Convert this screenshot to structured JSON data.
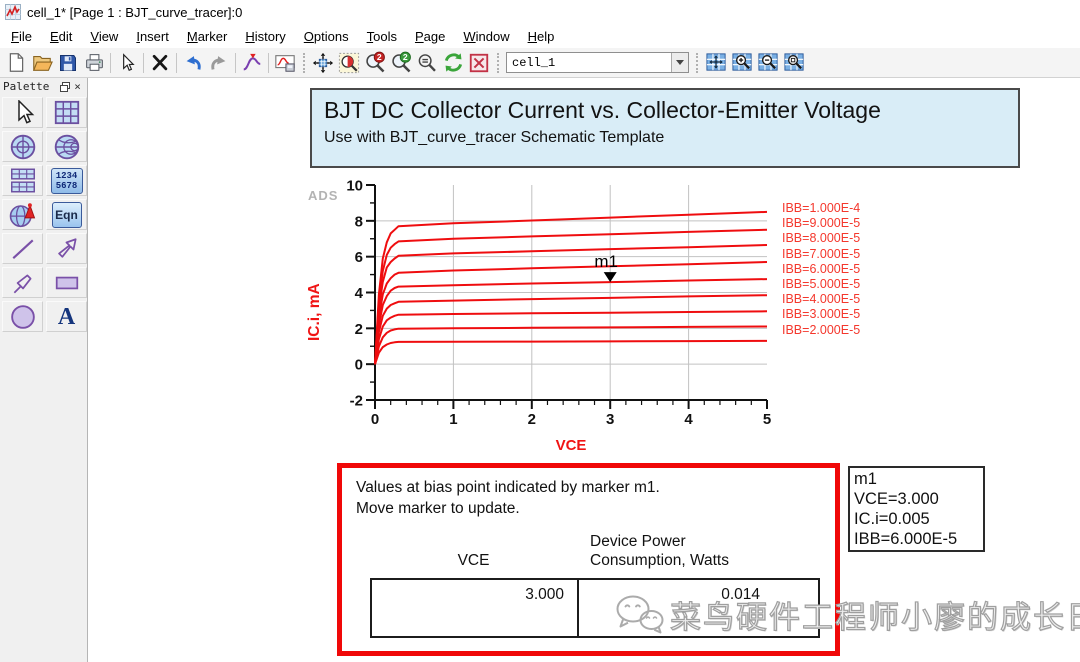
{
  "window": {
    "icon": "app-dataset-icon",
    "title": "cell_1* [Page 1 : BJT_curve_tracer]:0"
  },
  "menu": {
    "items": [
      "File",
      "Edit",
      "View",
      "Insert",
      "Marker",
      "History",
      "Options",
      "Tools",
      "Page",
      "Window",
      "Help"
    ]
  },
  "toolbar": {
    "cell_selector_value": "cell_1",
    "icons": [
      "new-file",
      "open-folder",
      "save",
      "print",
      "pointer",
      "delete",
      "undo",
      "redo",
      "insert-marker",
      "export-plot",
      "pan-view",
      "zoom-area",
      "zoom-in-2x",
      "zoom-out-2x",
      "zoom-out",
      "refresh",
      "close-window",
      "grid-pan",
      "grid-zoom-in",
      "grid-zoom-out",
      "grid-zoom-area"
    ]
  },
  "palette": {
    "title": "Palette",
    "tools": [
      "pointer",
      "rectangular-plot",
      "polar-plot",
      "smith-chart",
      "stacked-plot",
      "list-plot",
      "antenna-plot",
      "equation",
      "line",
      "arrow-shape",
      "polyline-arrow",
      "rectangle",
      "circle",
      "text"
    ],
    "list_plot_label_top": "1234",
    "list_plot_label_bottom": "5678",
    "equation_label": "Eqn",
    "text_label": "A"
  },
  "page": {
    "header": {
      "title": "BJT DC Collector Current vs. Collector-Emitter Voltage",
      "subtitle": "Use with BJT_curve_tracer Schematic Template"
    },
    "ads_watermark": "ADS",
    "note_box": {
      "line1": "Values at bias point indicated by marker m1.",
      "line2": "Move marker to update.",
      "col1_header": "VCE",
      "col2_header_line1": "Device Power",
      "col2_header_line2": "Consumption, Watts",
      "col1_value": "3.000",
      "col2_value": "0.014"
    },
    "marker_readout": {
      "lines": [
        "m1",
        "VCE=3.000",
        "IC.i=0.005",
        "IBB=6.000E-5"
      ]
    },
    "watermark": {
      "icon": "wechat-icon",
      "text": "菜鸟硬件工程师小廖的成长日记"
    }
  },
  "chart_data": {
    "type": "line",
    "title": "",
    "xlabel": "VCE",
    "ylabel": "IC.i, mA",
    "xlim": [
      0,
      5
    ],
    "ylim": [
      -2,
      10
    ],
    "x_major_ticks": [
      0,
      1,
      2,
      3,
      4,
      5
    ],
    "x_minor_step": 0.2,
    "y_major_ticks": [
      -2,
      0,
      2,
      4,
      6,
      8,
      10
    ],
    "y_minor_step": 1,
    "grid": true,
    "legend_position": "right",
    "line_color": "#ef0d0f",
    "x": [
      0,
      0.05,
      0.1,
      0.15,
      0.2,
      0.25,
      0.3,
      1,
      2,
      3,
      4,
      5
    ],
    "series": [
      {
        "name": "IBB=1.000E-4",
        "values": [
          0,
          3.9,
          5.9,
          6.8,
          7.3,
          7.5,
          7.7,
          7.86,
          8.02,
          8.18,
          8.34,
          8.5
        ]
      },
      {
        "name": "IBB=9.000E-5",
        "values": [
          0,
          3.5,
          5.2,
          6.1,
          6.5,
          6.7,
          6.85,
          7.0,
          7.13,
          7.25,
          7.38,
          7.5
        ]
      },
      {
        "name": "IBB=8.000E-5",
        "values": [
          0,
          3.1,
          4.6,
          5.4,
          5.7,
          5.9,
          6.05,
          6.18,
          6.3,
          6.42,
          6.53,
          6.65
        ]
      },
      {
        "name": "IBB=7.000E-5",
        "values": [
          0,
          2.6,
          3.9,
          4.5,
          4.8,
          5.0,
          5.1,
          5.23,
          5.35,
          5.46,
          5.58,
          5.7
        ]
      },
      {
        "name": "IBB=6.000E-5",
        "values": [
          0,
          2.2,
          3.3,
          3.8,
          4.1,
          4.25,
          4.33,
          4.41,
          4.5,
          4.58,
          4.67,
          4.75
        ]
      },
      {
        "name": "IBB=5.000E-5",
        "values": [
          0,
          1.8,
          2.7,
          3.1,
          3.3,
          3.4,
          3.48,
          3.55,
          3.63,
          3.7,
          3.78,
          3.85
        ]
      },
      {
        "name": "IBB=4.000E-5",
        "values": [
          0,
          1.4,
          2.1,
          2.45,
          2.6,
          2.7,
          2.76,
          2.8,
          2.84,
          2.87,
          2.91,
          2.95
        ]
      },
      {
        "name": "IBB=3.000E-5",
        "values": [
          0,
          1.0,
          1.5,
          1.75,
          1.88,
          1.94,
          1.98,
          2.0,
          2.03,
          2.05,
          2.08,
          2.1
        ]
      },
      {
        "name": "IBB=2.000E-5",
        "values": [
          0,
          0.64,
          0.95,
          1.1,
          1.18,
          1.22,
          1.24,
          1.25,
          1.26,
          1.27,
          1.29,
          1.3
        ]
      }
    ],
    "marker": {
      "label": "m1",
      "x": 3,
      "y": 4.58,
      "series": "IBB=6.000E-5"
    }
  }
}
